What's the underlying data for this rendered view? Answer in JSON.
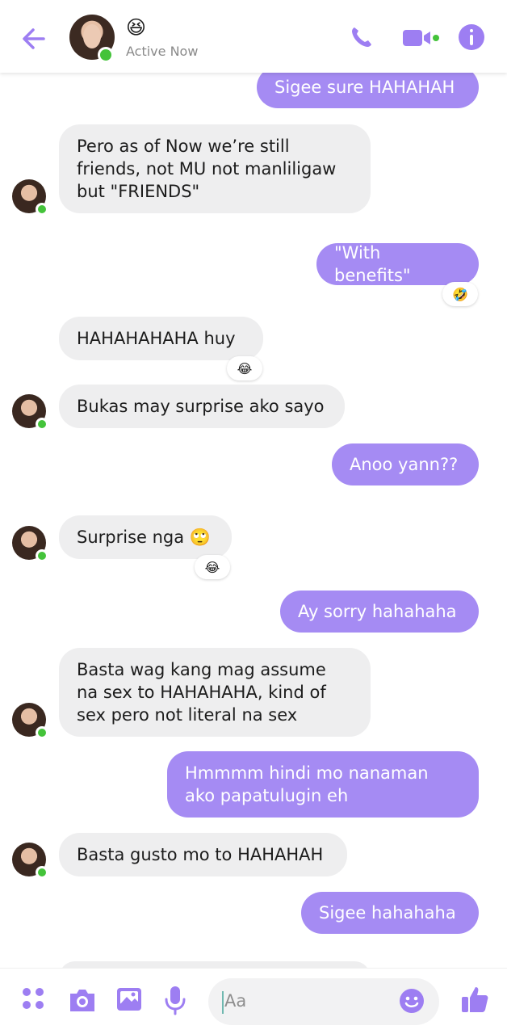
{
  "header": {
    "status_emoji": "😆",
    "status_text": "Active Now"
  },
  "messages": [
    {
      "side": "out",
      "text": "Sigee sure HAHAHAH"
    },
    {
      "side": "in",
      "lines": [
        "Pero as of Now we’re still",
        "friends, not MU not manliligaw",
        "but \"FRIENDS\""
      ]
    },
    {
      "side": "out",
      "text": "\"With benefits\"",
      "reaction": "🤣"
    },
    {
      "side": "in",
      "text": "HAHAHAHAHA huy",
      "reaction": "😂"
    },
    {
      "side": "in",
      "text": "Bukas may surprise ako sayo"
    },
    {
      "side": "out",
      "text": "Anoo yann??"
    },
    {
      "side": "in",
      "text": "Surprise nga 🙄",
      "reaction": "😂"
    },
    {
      "side": "out",
      "text": "Ay sorry hahahaha"
    },
    {
      "side": "in",
      "lines": [
        "Basta wag kang mag assume",
        "na sex to HAHAHAHA, kind of",
        "sex pero not literal na sex"
      ]
    },
    {
      "side": "out",
      "lines": [
        "Hmmmm hindi mo nanaman",
        "ako papatulugin eh"
      ]
    },
    {
      "side": "in",
      "text": "Basta gusto mo to HAHAHAH"
    },
    {
      "side": "out",
      "text": "Sigee hahahaha"
    }
  ],
  "composer": {
    "placeholder": "Aa"
  },
  "colors": {
    "accent": "#9d7ef2",
    "outgoing_bubble": "#a58bf3",
    "incoming_bubble": "#eeeeef",
    "online": "#44c33a"
  },
  "icons": [
    "back-arrow-icon",
    "phone-icon",
    "video-camera-icon",
    "info-icon",
    "grid-menu-icon",
    "camera-icon",
    "gallery-icon",
    "microphone-icon",
    "emoji-icon",
    "thumbs-up-icon"
  ]
}
